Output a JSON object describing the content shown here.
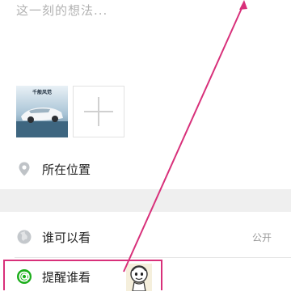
{
  "composer": {
    "placeholder": "这一刻的想法...",
    "photo_caption": "千般风范"
  },
  "rows": {
    "location_label": "所在位置",
    "visibility_label": "谁可以看",
    "visibility_value": "公开",
    "remind_label": "提醒谁看"
  },
  "colors": {
    "accent_green": "#1aad19",
    "annotation_pink": "#d8307a"
  },
  "icons": {
    "location": "location-pin-icon",
    "visibility": "globe-icon",
    "remind": "at-sign-icon",
    "add": "plus-icon"
  }
}
